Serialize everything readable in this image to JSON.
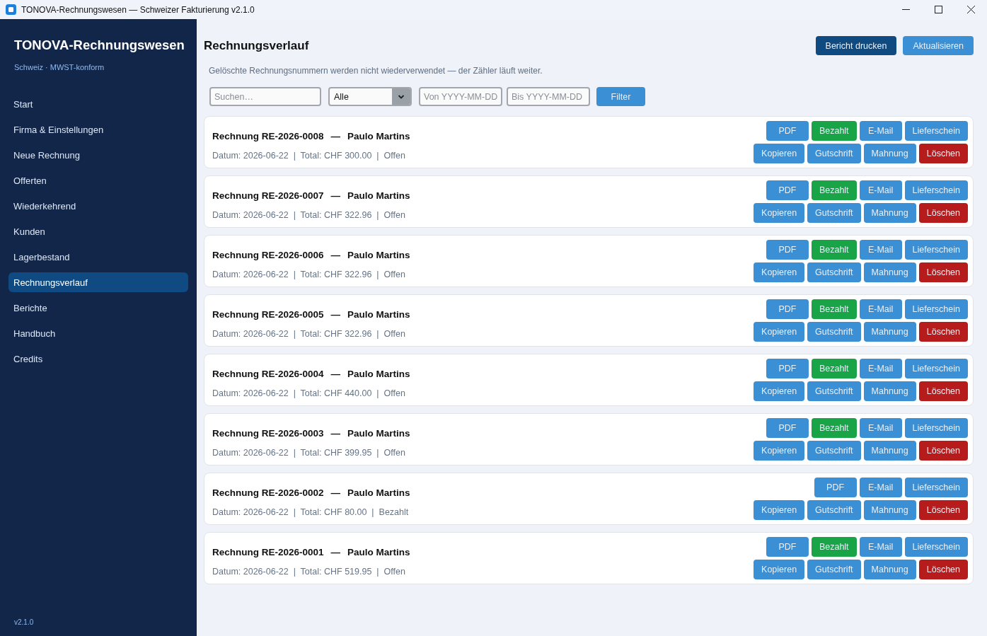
{
  "window": {
    "title": "TONOVA-Rechnungswesen — Schweizer Fakturierung v2.1.0"
  },
  "sidebar": {
    "app_name": "TONOVA-Rechnungswesen",
    "tagline": "Schweiz · MWST-konform",
    "items": [
      {
        "label": "Start",
        "selected": false
      },
      {
        "label": "Firma & Einstellungen",
        "selected": false
      },
      {
        "label": "Neue Rechnung",
        "selected": false
      },
      {
        "label": "Offerten",
        "selected": false
      },
      {
        "label": "Wiederkehrend",
        "selected": false
      },
      {
        "label": "Kunden",
        "selected": false
      },
      {
        "label": "Lagerbestand",
        "selected": false
      },
      {
        "label": "Rechnungsverlauf",
        "selected": true
      },
      {
        "label": "Berichte",
        "selected": false
      },
      {
        "label": "Handbuch",
        "selected": false
      },
      {
        "label": "Credits",
        "selected": false
      }
    ],
    "version": "v2.1.0"
  },
  "header": {
    "title": "Rechnungsverlauf",
    "buttons": [
      {
        "label": "Bericht drucken",
        "kind": "dark"
      },
      {
        "label": "Aktualisieren",
        "kind": "primary"
      }
    ]
  },
  "note": "Gelöschte Rechnungsnummern werden nicht wiederverwendet — der Zähler läuft weiter.",
  "filters": {
    "search": {
      "placeholder": "Suchen…"
    },
    "status": {
      "value": "Alle"
    },
    "date_from": {
      "placeholder": "Von YYYY-MM-DD"
    },
    "date_to": {
      "placeholder": "Bis YYYY-MM-DD"
    },
    "button": "Filter"
  },
  "invoices": [
    {
      "title": "Rechnung RE-2026-0008",
      "separator": "—",
      "customer": "Paulo Martins",
      "meta": "Datum: 2026-06-22  |  Total: CHF 300.00  |  Offen",
      "action_rows": [
        [
          {
            "label": "PDF",
            "kind": "primary"
          },
          {
            "label": "Bezahlt",
            "kind": "success"
          },
          {
            "label": "E-Mail",
            "kind": "primary"
          },
          {
            "label": "Lieferschein",
            "kind": "primary"
          }
        ],
        [
          {
            "label": "Kopieren",
            "kind": "primary"
          },
          {
            "label": "Gutschrift",
            "kind": "primary"
          },
          {
            "label": "Mahnung",
            "kind": "primary"
          },
          {
            "label": "Löschen",
            "kind": "danger"
          }
        ]
      ]
    },
    {
      "title": "Rechnung RE-2026-0007",
      "separator": "—",
      "customer": "Paulo Martins",
      "meta": "Datum: 2026-06-22  |  Total: CHF 322.96  |  Offen",
      "action_rows": [
        [
          {
            "label": "PDF",
            "kind": "primary"
          },
          {
            "label": "Bezahlt",
            "kind": "success"
          },
          {
            "label": "E-Mail",
            "kind": "primary"
          },
          {
            "label": "Lieferschein",
            "kind": "primary"
          }
        ],
        [
          {
            "label": "Kopieren",
            "kind": "primary"
          },
          {
            "label": "Gutschrift",
            "kind": "primary"
          },
          {
            "label": "Mahnung",
            "kind": "primary"
          },
          {
            "label": "Löschen",
            "kind": "danger"
          }
        ]
      ]
    },
    {
      "title": "Rechnung RE-2026-0006",
      "separator": "—",
      "customer": "Paulo Martins",
      "meta": "Datum: 2026-06-22  |  Total: CHF 322.96  |  Offen",
      "action_rows": [
        [
          {
            "label": "PDF",
            "kind": "primary"
          },
          {
            "label": "Bezahlt",
            "kind": "success"
          },
          {
            "label": "E-Mail",
            "kind": "primary"
          },
          {
            "label": "Lieferschein",
            "kind": "primary"
          }
        ],
        [
          {
            "label": "Kopieren",
            "kind": "primary"
          },
          {
            "label": "Gutschrift",
            "kind": "primary"
          },
          {
            "label": "Mahnung",
            "kind": "primary"
          },
          {
            "label": "Löschen",
            "kind": "danger"
          }
        ]
      ]
    },
    {
      "title": "Rechnung RE-2026-0005",
      "separator": "—",
      "customer": "Paulo Martins",
      "meta": "Datum: 2026-06-22  |  Total: CHF 322.96  |  Offen",
      "action_rows": [
        [
          {
            "label": "PDF",
            "kind": "primary"
          },
          {
            "label": "Bezahlt",
            "kind": "success"
          },
          {
            "label": "E-Mail",
            "kind": "primary"
          },
          {
            "label": "Lieferschein",
            "kind": "primary"
          }
        ],
        [
          {
            "label": "Kopieren",
            "kind": "primary"
          },
          {
            "label": "Gutschrift",
            "kind": "primary"
          },
          {
            "label": "Mahnung",
            "kind": "primary"
          },
          {
            "label": "Löschen",
            "kind": "danger"
          }
        ]
      ]
    },
    {
      "title": "Rechnung RE-2026-0004",
      "separator": "—",
      "customer": "Paulo Martins",
      "meta": "Datum: 2026-06-22  |  Total: CHF 440.00  |  Offen",
      "action_rows": [
        [
          {
            "label": "PDF",
            "kind": "primary"
          },
          {
            "label": "Bezahlt",
            "kind": "success"
          },
          {
            "label": "E-Mail",
            "kind": "primary"
          },
          {
            "label": "Lieferschein",
            "kind": "primary"
          }
        ],
        [
          {
            "label": "Kopieren",
            "kind": "primary"
          },
          {
            "label": "Gutschrift",
            "kind": "primary"
          },
          {
            "label": "Mahnung",
            "kind": "primary"
          },
          {
            "label": "Löschen",
            "kind": "danger"
          }
        ]
      ]
    },
    {
      "title": "Rechnung RE-2026-0003",
      "separator": "—",
      "customer": "Paulo Martins",
      "meta": "Datum: 2026-06-22  |  Total: CHF 399.95  |  Offen",
      "action_rows": [
        [
          {
            "label": "PDF",
            "kind": "primary"
          },
          {
            "label": "Bezahlt",
            "kind": "success"
          },
          {
            "label": "E-Mail",
            "kind": "primary"
          },
          {
            "label": "Lieferschein",
            "kind": "primary"
          }
        ],
        [
          {
            "label": "Kopieren",
            "kind": "primary"
          },
          {
            "label": "Gutschrift",
            "kind": "primary"
          },
          {
            "label": "Mahnung",
            "kind": "primary"
          },
          {
            "label": "Löschen",
            "kind": "danger"
          }
        ]
      ]
    },
    {
      "title": "Rechnung RE-2026-0002",
      "separator": "—",
      "customer": "Paulo Martins",
      "meta": "Datum: 2026-06-22  |  Total: CHF 80.00  |  Bezahlt",
      "action_rows": [
        [
          {
            "label": "PDF",
            "kind": "primary"
          },
          {
            "label": "E-Mail",
            "kind": "primary"
          },
          {
            "label": "Lieferschein",
            "kind": "primary"
          }
        ],
        [
          {
            "label": "Kopieren",
            "kind": "primary"
          },
          {
            "label": "Gutschrift",
            "kind": "primary"
          },
          {
            "label": "Mahnung",
            "kind": "primary"
          },
          {
            "label": "Löschen",
            "kind": "danger"
          }
        ]
      ]
    },
    {
      "title": "Rechnung RE-2026-0001",
      "separator": "—",
      "customer": "Paulo Martins",
      "meta": "Datum: 2026-06-22  |  Total: CHF 519.95  |  Offen",
      "action_rows": [
        [
          {
            "label": "PDF",
            "kind": "primary"
          },
          {
            "label": "Bezahlt",
            "kind": "success"
          },
          {
            "label": "E-Mail",
            "kind": "primary"
          },
          {
            "label": "Lieferschein",
            "kind": "primary"
          }
        ],
        [
          {
            "label": "Kopieren",
            "kind": "primary"
          },
          {
            "label": "Gutschrift",
            "kind": "primary"
          },
          {
            "label": "Mahnung",
            "kind": "primary"
          },
          {
            "label": "Löschen",
            "kind": "danger"
          }
        ]
      ]
    }
  ]
}
